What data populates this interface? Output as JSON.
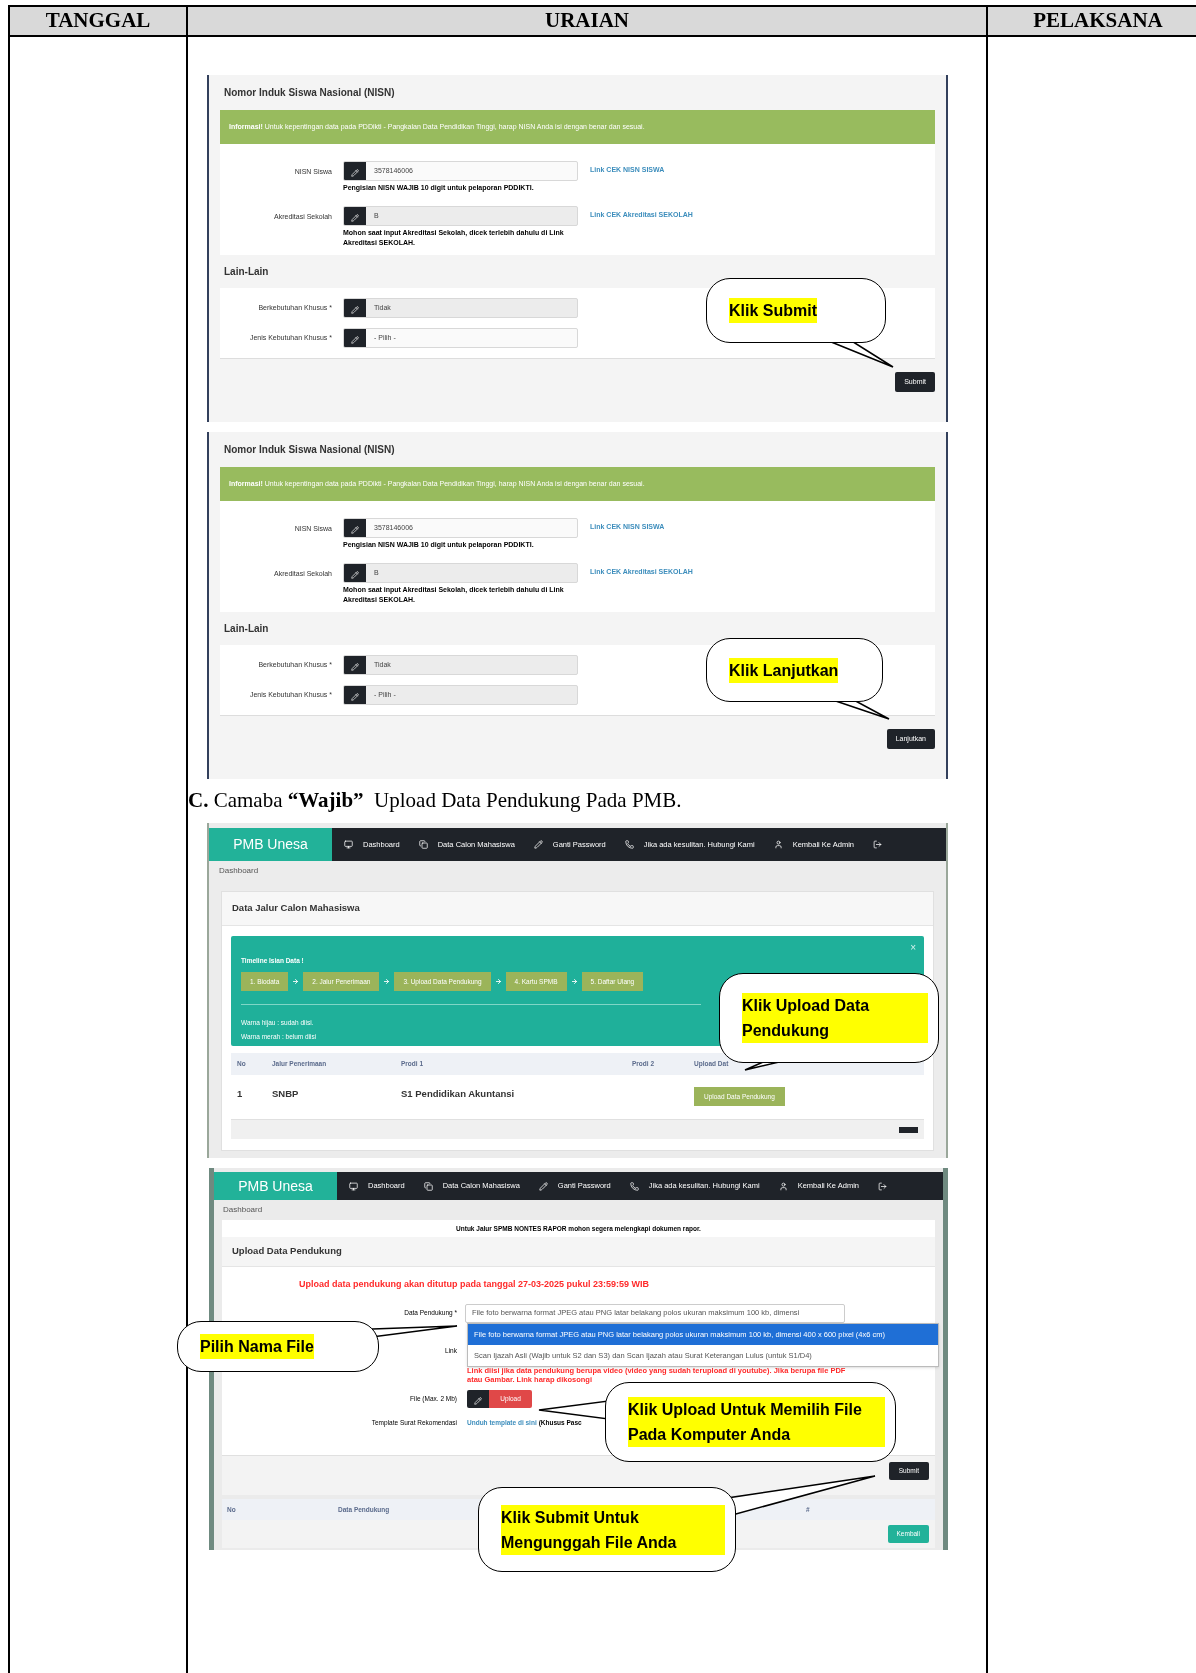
{
  "document": {
    "columns": [
      "TANGGAL",
      "URAIAN",
      "PELAKSANA"
    ]
  },
  "content": [
    {
      "kind": "nisn_form",
      "title": "Nomor Induk Siswa Nasional (NISN)",
      "alert": "**Informasi!** Untuk kepentingan data pada PDDikti - Pangkalan Data Pendidikan Tinggi, harap NISN Anda isi dengan benar dan sesuai.",
      "fields": [
        {
          "label": "NISN Siswa",
          "value": "3578146006",
          "disabled": false,
          "note": "Pengisian NISN WAJIB 10 digit untuk pelaporan PDDIKTI.",
          "link": "Link CEK NISN SISWA"
        },
        {
          "label": "Akreditasi Sekolah",
          "value": "B",
          "disabled": true,
          "note": "Mohon saat input Akreditasi Sekolah, dicek terlebih dahulu di Link Akreditasi SEKOLAH.",
          "link": "Link CEK Akreditasi SEKOLAH"
        }
      ],
      "section": "Lain-Lain",
      "fields2": [
        {
          "label": "Berkebutuhan Khusus *",
          "value": "Tidak",
          "disabled": true
        },
        {
          "label": "Jenis Kebutuhan Khusus *",
          "value": "- Pilih -",
          "disabled": false
        }
      ],
      "button": "Submit",
      "callout": "Klik Submit"
    },
    {
      "kind": "nisn_form",
      "title": "Nomor Induk Siswa Nasional (NISN)",
      "alert": "**Informasi!** Untuk kepentingan data pada PDDikti - Pangkalan Data Pendidikan Tinggi, harap NISN Anda isi dengan benar dan sesuai.",
      "fields": [
        {
          "label": "NISN Siswa",
          "value": "3578146006",
          "disabled": false,
          "note": "Pengisian NISN WAJIB 10 digit untuk pelaporan PDDIKTI.",
          "link": "Link CEK NISN SISWA"
        },
        {
          "label": "Akreditasi Sekolah",
          "value": "B",
          "disabled": true,
          "note": "Mohon saat input Akreditasi Sekolah, dicek terlebih dahulu di Link Akreditasi SEKOLAH.",
          "link": "Link CEK Akreditasi SEKOLAH"
        }
      ],
      "section": "Lain-Lain",
      "fields2": [
        {
          "label": "Berkebutuhan Khusus *",
          "value": "Tidak",
          "disabled": true
        },
        {
          "label": "Jenis Kebutuhan Khusus *",
          "value": "- Pilih -",
          "disabled": true
        }
      ],
      "button": "Lanjutkan",
      "callout": "Klik Lanjutkan"
    },
    {
      "kind": "heading",
      "text": "**C.** Camaba **“Wajib”**  Upload Data Pendukung Pada PMB."
    },
    {
      "kind": "dashboard",
      "brand": "PMB Unesa",
      "nav": [
        "Dashboard",
        "Data Calon Mahasiswa",
        "Ganti Password",
        "Jika ada kesulitan. Hubungi Kami",
        "Kembali Ke Admin"
      ],
      "breadcrumb": "Dashboard",
      "title": "Data Jalur Calon Mahasiswa",
      "timeline": {
        "title": "Timeline Isian Data !",
        "close": "×",
        "steps": [
          "1. Biodata",
          "2. Jalur Penerimaan",
          "3. Upload Data Pendukung",
          "4. Kartu SPMB",
          "5. Daftar Ulang"
        ],
        "legend": [
          "Warna hijau : sudah diisi.",
          "Warna merah : belum diisi"
        ]
      },
      "columns": [
        "No",
        "Jalur Penerimaan",
        "Prodi 1",
        "Prodi 2",
        "Upload Dat"
      ],
      "row": {
        "no": "1",
        "jalur": "SNBP",
        "prodi1": "S1 Pendidikan Akuntansi",
        "button": "Upload Data Pendukung"
      },
      "callout": "Klik Upload Data Pendukung"
    },
    {
      "kind": "upload",
      "brand": "PMB Unesa",
      "nav": [
        "Dashboard",
        "Data Calon Mahasiswa",
        "Ganti Password",
        "Jika ada kesulitan. Hubungi Kami",
        "Kembali Ke Admin"
      ],
      "breadcrumb": "Dashboard",
      "notice": "Untuk Jalur SPMB NONTES RAPOR mohon segera melengkapi dokumen rapor.",
      "title": "Upload Data Pendukung",
      "deadline": "Upload data pendukung akan ditutup pada tanggal 27-03-2025 pukul 23:59:59 WIB",
      "select": {
        "label": "Data Pendukung *",
        "value": "File foto berwarna format JPEG atau PNG latar belakang polos ukuran maksimum 100 kb, dimensi",
        "options": [
          {
            "text": "File foto berwarna format JPEG atau PNG latar belakang polos ukuran maksimum 100 kb, dimensi 400 x 600 pixel (4x6 cm)",
            "selected": true
          },
          {
            "text": "Scan Ijazah Asli (Wajib untuk S2 dan S3) dan Scan Ijazah atau Surat Keterangan Lulus (untuk S1/D4)",
            "selected": false
          }
        ]
      },
      "link_label": "Link",
      "link_help": "Link diisi jika data pendukung berupa video (video yang sudah terupload di youtube). Jika berupa file PDF atau Gambar. Link harap dikosongi",
      "file_label": "File (Max. 2 Mb)",
      "upload_button": "Upload",
      "template_label": "Template Surat Rekomendasi",
      "template_link": "Unduh template di sini",
      "template_note": "(Khusus Pasc",
      "submit": "Submit",
      "columns": [
        "No",
        "Data Pendukung",
        "#"
      ],
      "back": "Kembali",
      "callouts": [
        "Pilih Nama File",
        "Klik Upload Untuk Memilih File Pada Komputer Anda",
        "Klik Submit Untuk Mengunggah File Anda"
      ]
    }
  ]
}
